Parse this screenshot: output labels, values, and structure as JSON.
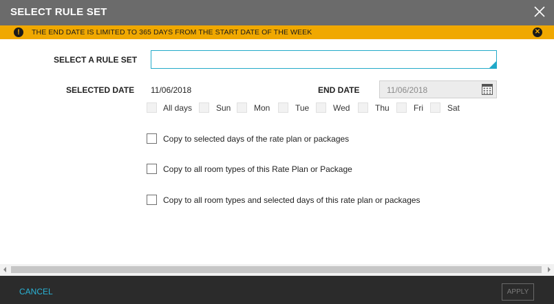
{
  "dialog": {
    "title": "SELECT RULE SET",
    "close_icon": "close-icon"
  },
  "warning": {
    "icon": "exclamation-icon",
    "text": "THE END DATE IS LIMITED TO 365 DAYS FROM THE START DATE OF THE WEEK",
    "close_icon": "close-circle-icon",
    "background": "#f0a800"
  },
  "form": {
    "ruleset_label": "SELECT A RULE SET",
    "ruleset_value": "",
    "selected_date_label": "SELECTED DATE",
    "selected_date_value": "11/06/2018",
    "end_date_label": "END DATE",
    "end_date_value": "11/06/2018",
    "calendar_icon": "calendar-icon",
    "days": [
      {
        "label": "All days",
        "checked": false
      },
      {
        "label": "Sun",
        "checked": false
      },
      {
        "label": "Mon",
        "checked": false
      },
      {
        "label": "Tue",
        "checked": false
      },
      {
        "label": "Wed",
        "checked": false
      },
      {
        "label": "Thu",
        "checked": false
      },
      {
        "label": "Fri",
        "checked": false
      },
      {
        "label": "Sat",
        "checked": false
      }
    ],
    "options": [
      {
        "label": "Copy to selected days of the rate plan or packages",
        "checked": false
      },
      {
        "label": "Copy to all room types of this Rate Plan or Package",
        "checked": false
      },
      {
        "label": "Copy to all room types and selected days of this rate plan or packages",
        "checked": false
      }
    ]
  },
  "footer": {
    "cancel_label": "CANCEL",
    "apply_label": "APPLY"
  },
  "colors": {
    "header": "#6b6b6b",
    "accent": "#21a9c9",
    "footer": "#2b2b2b"
  }
}
